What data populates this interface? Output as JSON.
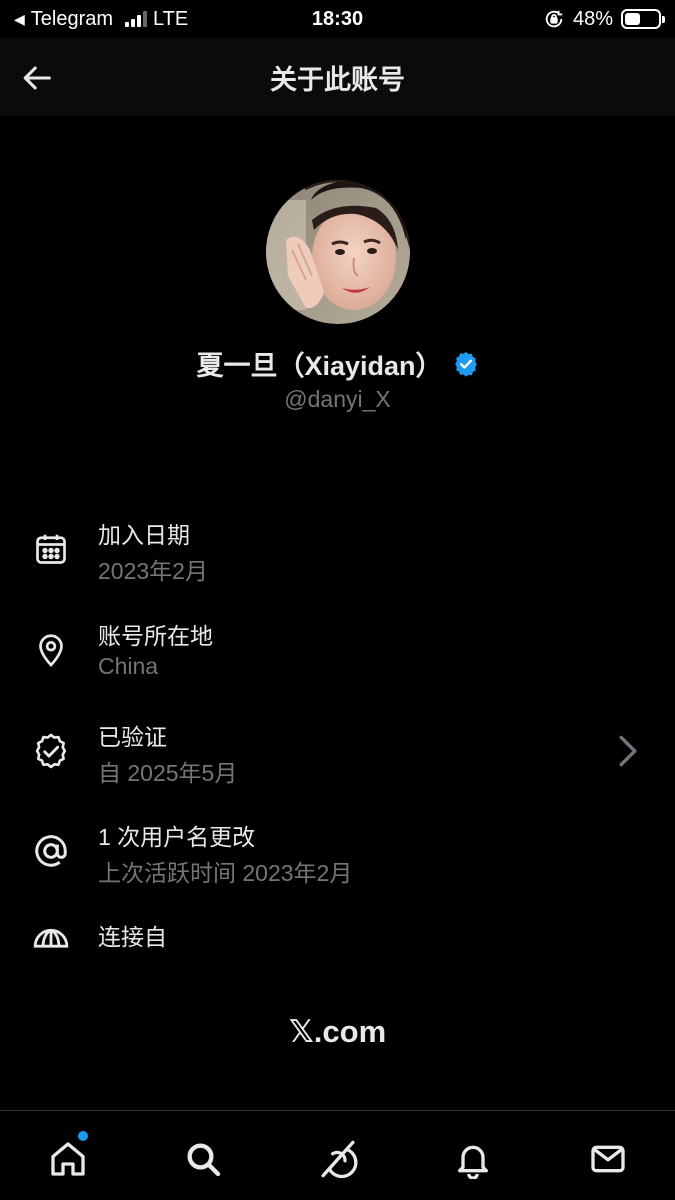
{
  "status_bar": {
    "back_app": "Telegram",
    "network": "LTE",
    "time": "18:30",
    "battery": "48%",
    "battery_level": 0.48
  },
  "header": {
    "title": "关于此账号",
    "back_icon": "arrow-left-icon"
  },
  "profile": {
    "name": "夏一旦（Xiayidan）",
    "handle": "@danyi_X",
    "verified_icon": "verified-badge-icon",
    "verified_color": "#1d9bf0"
  },
  "info": [
    {
      "icon": "calendar-icon",
      "title": "加入日期",
      "sub": "2023年2月"
    },
    {
      "icon": "location-pin-icon",
      "title": "账号所在地",
      "sub": "China"
    },
    {
      "icon": "verified-outline-icon",
      "title": "已验证",
      "sub": "自 2025年5月"
    },
    {
      "icon": "at-sign-icon",
      "title": "1 次用户名更改",
      "sub": "上次活跃时间 2023年2月"
    },
    {
      "icon": "umbrella-icon",
      "title": "连接自",
      "sub": ""
    }
  ],
  "footer": {
    "logo": "𝕏.com"
  },
  "tabbar": [
    {
      "icon": "home-icon",
      "badge": true
    },
    {
      "icon": "search-icon",
      "badge": false
    },
    {
      "icon": "grok-icon",
      "badge": false
    },
    {
      "icon": "bell-icon",
      "badge": false
    },
    {
      "icon": "mail-icon",
      "badge": false
    }
  ],
  "colors": {
    "background": "#000000",
    "secondary_text": "#71767b",
    "accent": "#1d9bf0"
  }
}
